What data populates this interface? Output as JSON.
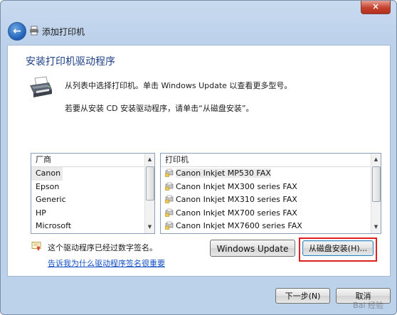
{
  "window": {
    "close_label": "×",
    "nav_title": "添加打印机"
  },
  "main": {
    "heading": "安装打印机驱动程序",
    "instruction_1": "从列表中选择打印机。单击 Windows Update 以查看更多型号。",
    "instruction_2": "若要从安装 CD 安装驱动程序，请单击“从磁盘安装”。"
  },
  "manufacturers": {
    "header": "厂商",
    "selected": "Canon",
    "items": [
      "Canon",
      "Epson",
      "Generic",
      "HP",
      "Microsoft"
    ]
  },
  "printers": {
    "header": "打印机",
    "selected": "Canon Inkjet MP530 FAX",
    "items": [
      "Canon Inkjet MP530 FAX",
      "Canon Inkjet MX300 series FAX",
      "Canon Inkjet MX310 series FAX",
      "Canon Inkjet MX700 series FAX",
      "Canon Inkjet MX7600 series FAX"
    ]
  },
  "signature": {
    "status_text": "这个驱动程序已经过数字签名。",
    "link_text": "告诉我为什么驱动程序签名很重要"
  },
  "buttons": {
    "windows_update": "Windows Update",
    "have_disk": "从磁盘安装(H)...",
    "next": "下一步(N)",
    "cancel": "取消"
  },
  "watermark": "Bai 经验",
  "colors": {
    "heading": "#1e3f86",
    "link": "#1550c3",
    "highlight_border": "#e0201e",
    "close_button": "#c4412d"
  }
}
